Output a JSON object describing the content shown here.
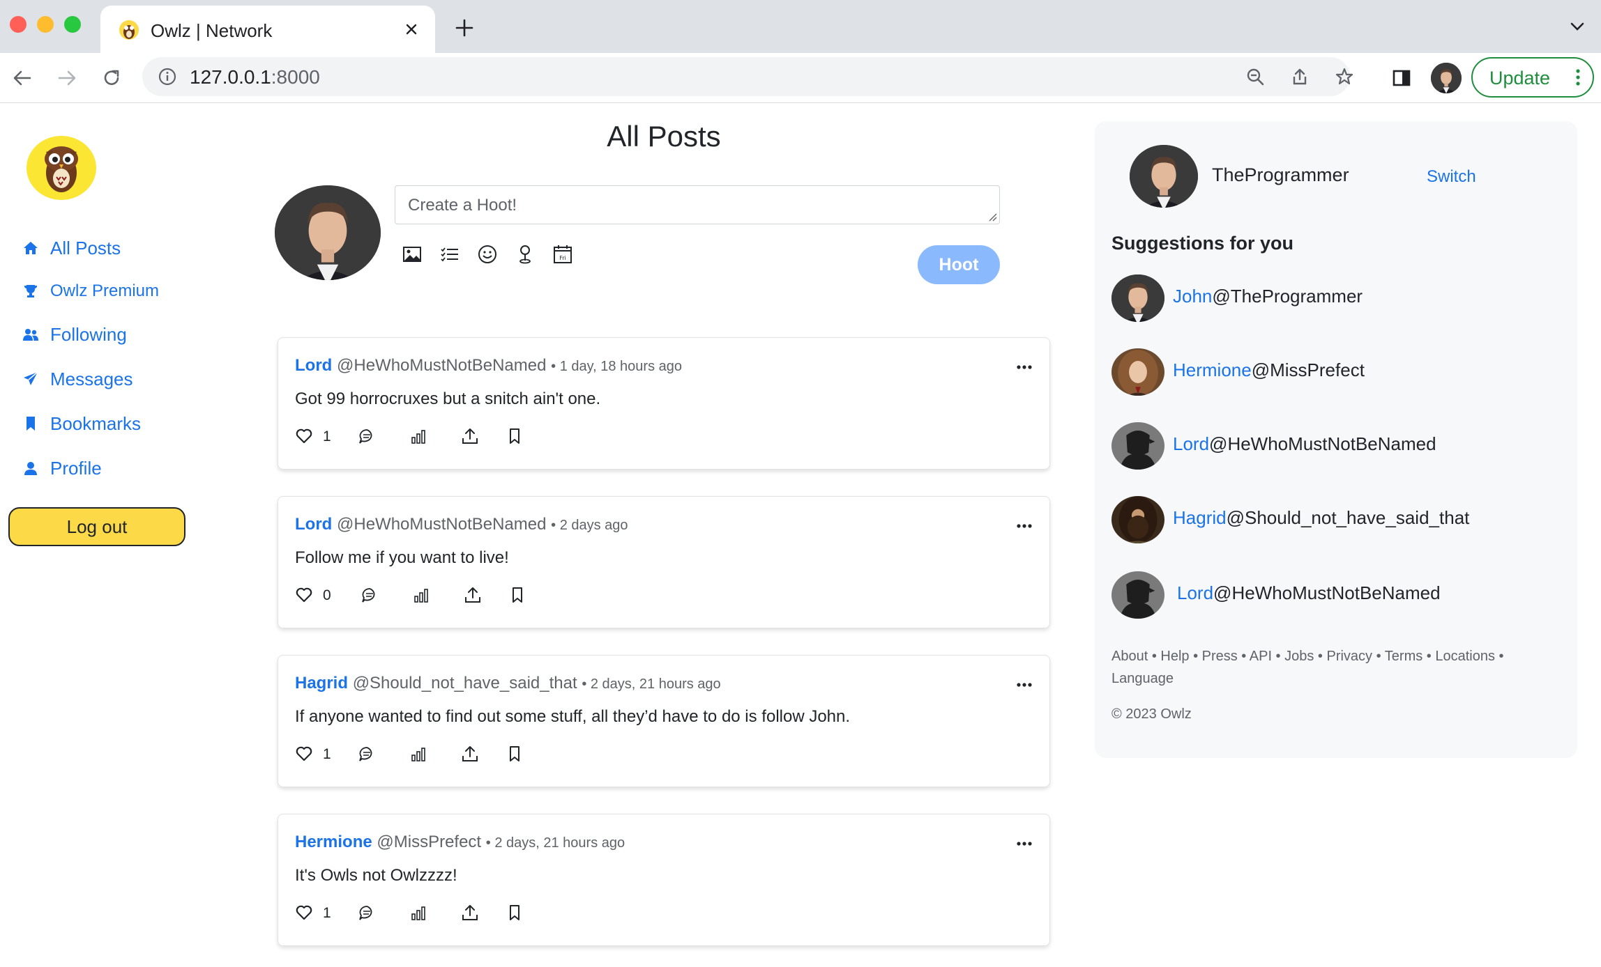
{
  "browser": {
    "tab_title": "Owlz | Network",
    "url_host": "127.0.0.1",
    "url_port": ":8000",
    "update_label": "Update"
  },
  "sidebar": {
    "items": [
      {
        "label": "All Posts",
        "icon": "home-icon"
      },
      {
        "label": "Owlz Premium",
        "icon": "trophy-icon"
      },
      {
        "label": "Following",
        "icon": "users-icon"
      },
      {
        "label": "Messages",
        "icon": "paper-plane-icon"
      },
      {
        "label": "Bookmarks",
        "icon": "bookmark-icon"
      },
      {
        "label": "Profile",
        "icon": "user-icon"
      }
    ],
    "logout_label": "Log out"
  },
  "main": {
    "title": "All Posts",
    "compose_placeholder": "Create a Hoot!",
    "hoot_label": "Hoot",
    "posts": [
      {
        "name": "Lord",
        "handle": "@HeWhoMustNotBeNamed",
        "time": "1 day, 18 hours ago",
        "body": "Got 99 horrocruxes but a snitch ain't one.",
        "likes": "1"
      },
      {
        "name": "Lord",
        "handle": "@HeWhoMustNotBeNamed",
        "time": "2 days ago",
        "body": "Follow me if you want to live!",
        "likes": "0"
      },
      {
        "name": "Hagrid",
        "handle": "@Should_not_have_said_that",
        "time": "2 days, 21 hours ago",
        "body": "If anyone wanted to find out some stuff, all they’d have to do is follow John.",
        "likes": "1"
      },
      {
        "name": "Hermione",
        "handle": "@MissPrefect",
        "time": "2 days, 21 hours ago",
        "body": "It's Owls not Owlzzzz!",
        "likes": "1"
      }
    ]
  },
  "right": {
    "current_user": "TheProgrammer",
    "switch_label": "Switch",
    "suggestions_title": "Suggestions for you",
    "suggestions": [
      {
        "name": "John",
        "handle": "@TheProgrammer"
      },
      {
        "name": "Hermione",
        "handle": "@MissPrefect"
      },
      {
        "name": "Lord",
        "handle": "@HeWhoMustNotBeNamed"
      },
      {
        "name": "Hagrid",
        "handle": "@Should_not_have_said_that"
      },
      {
        "name": "Lord",
        "handle": "@HeWhoMustNotBeNamed"
      }
    ],
    "footer_links": "About • Help • Press • API • Jobs • Privacy • Terms • Locations • Language",
    "copyright": "© 2023 Owlz"
  },
  "colors": {
    "link": "#1a73e8",
    "logout_bg": "#fbd947",
    "hoot_bg": "#8bb9fe",
    "update_green": "#1e8e3e"
  }
}
